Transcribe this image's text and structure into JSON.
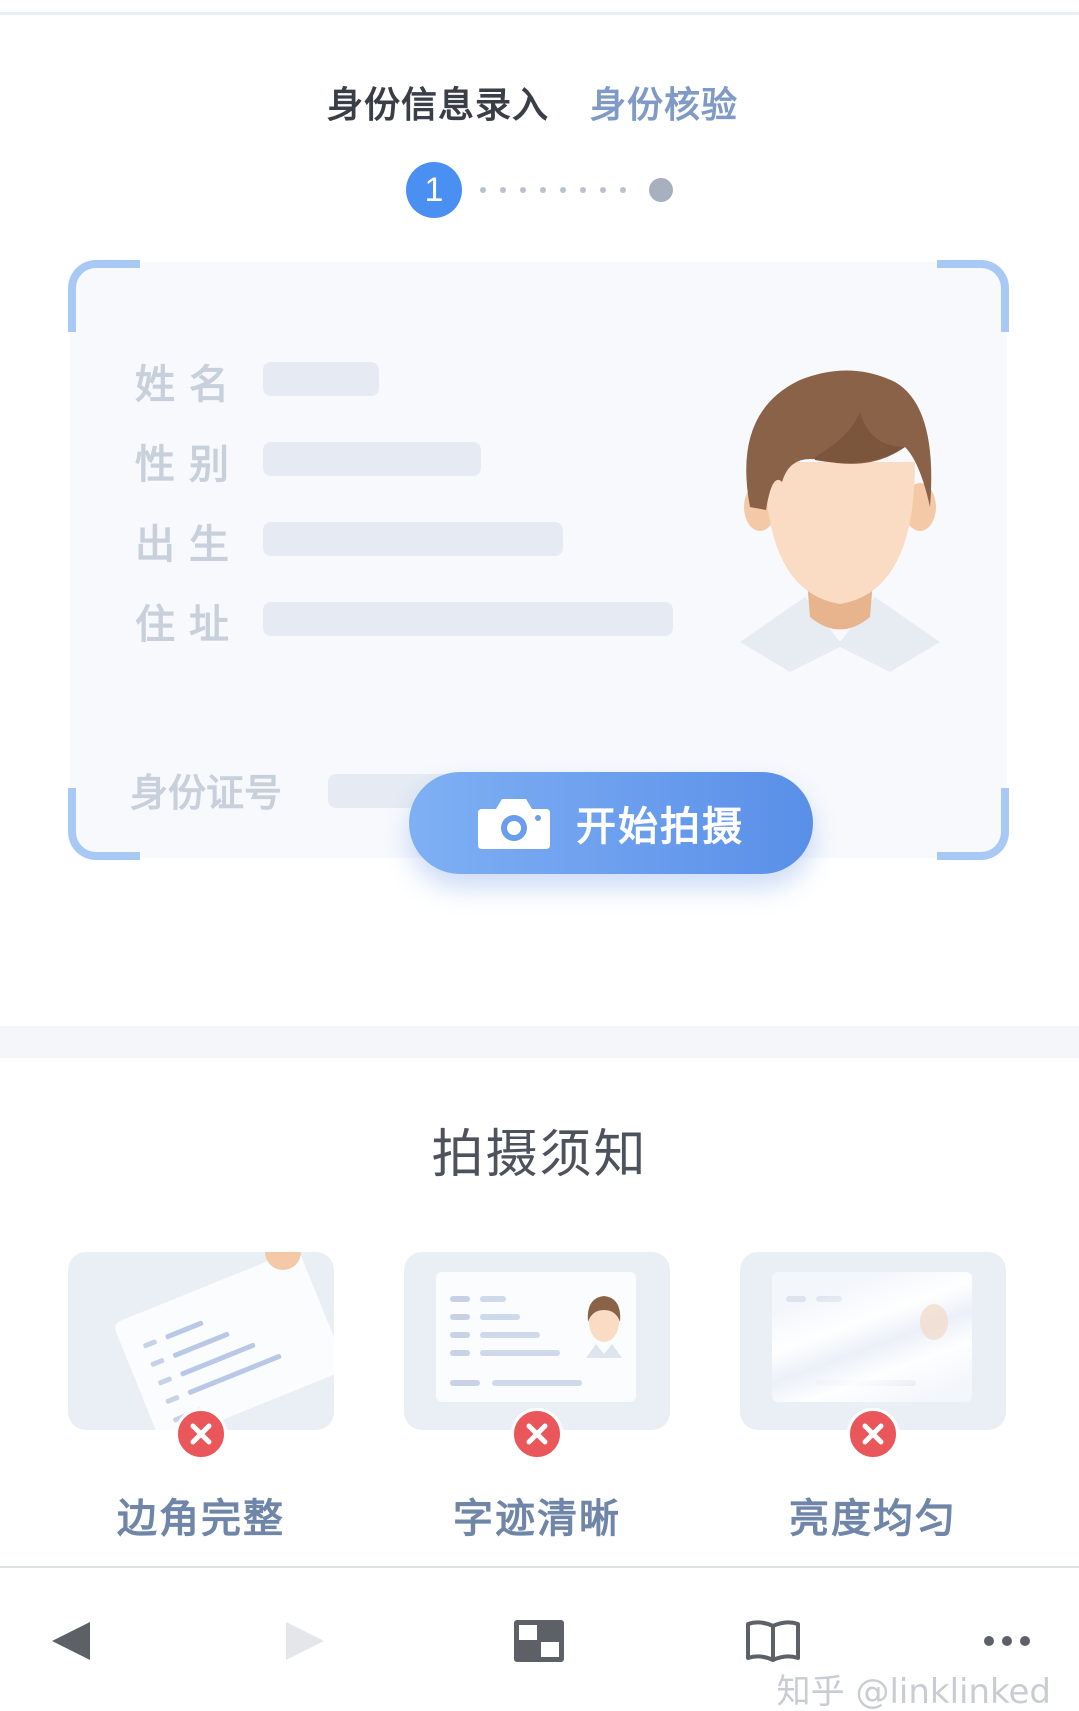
{
  "steps": {
    "step1_label": "身份信息录入",
    "step2_label": "身份核验",
    "current_number": "1"
  },
  "id_card": {
    "field_name": "姓名",
    "field_gender": "性别",
    "field_birth": "出生",
    "field_address": "住址",
    "field_id_number": "身份证号"
  },
  "shoot_button_label": "开始拍摄",
  "notice": {
    "title": "拍摄须知",
    "tips": [
      {
        "label": "边角完整"
      },
      {
        "label": "字迹清晰"
      },
      {
        "label": "亮度均匀"
      }
    ]
  },
  "toolbar": {
    "icons": [
      "back-arrow-icon",
      "forward-arrow-icon",
      "tabs-icon",
      "book-icon",
      "more-icon"
    ],
    "watermark": "知乎 @linklinked"
  },
  "colors": {
    "accent": "#4a8ff2",
    "error": "#e9575b",
    "frame": "#a9c9f5"
  }
}
